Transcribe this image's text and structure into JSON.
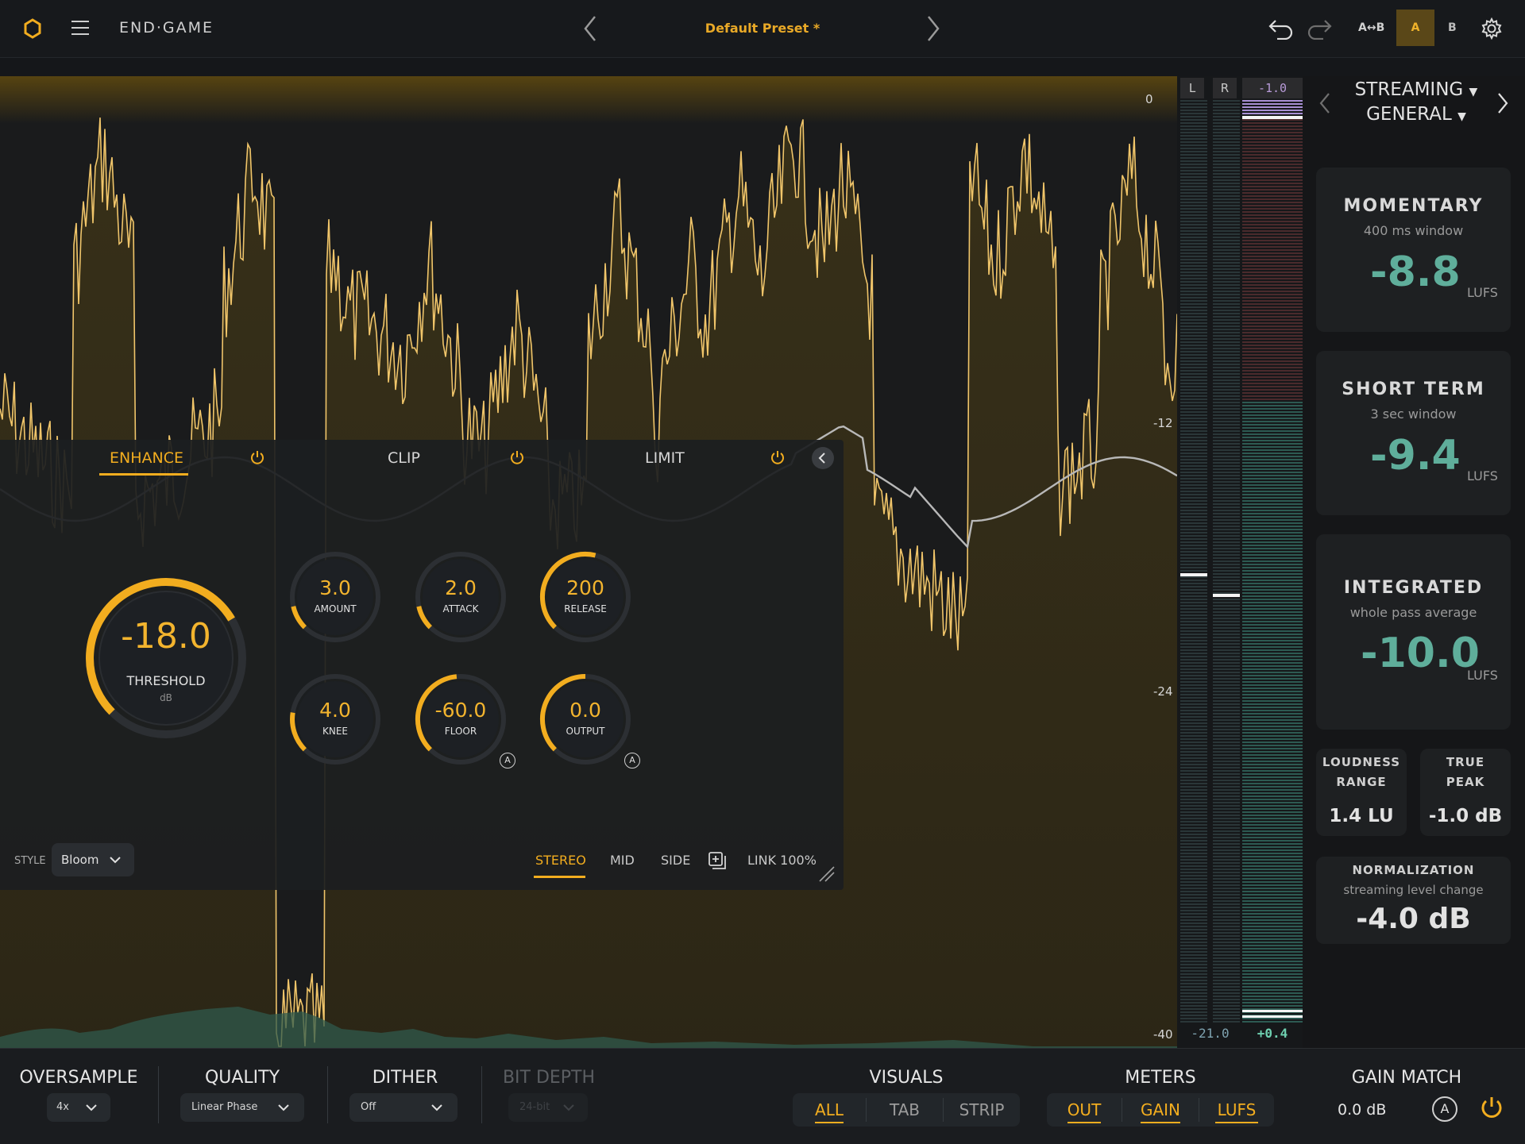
{
  "header": {
    "brand": "END·GAME",
    "preset": "Default Preset *",
    "ab_compare": "A↔B",
    "slot_a": "A",
    "slot_b": "B"
  },
  "spectrum": {
    "db_labels": [
      "0",
      "-12",
      "-24",
      "-40"
    ]
  },
  "meters": {
    "left_label": "L",
    "right_label": "R",
    "peak_top": "-1.0",
    "bottom_left": "-21.0",
    "bottom_right": "+0.4"
  },
  "panel": {
    "tabs": [
      "ENHANCE",
      "CLIP",
      "LIMIT"
    ],
    "active_tab": "ENHANCE",
    "threshold": {
      "value": "-18.0",
      "label": "THRESHOLD",
      "unit": "dB",
      "level": 0.72
    },
    "knobs": [
      {
        "value": "3.0",
        "label": "AMOUNT",
        "level": 0.12
      },
      {
        "value": "2.0",
        "label": "ATTACK",
        "level": 0.12
      },
      {
        "value": "200",
        "label": "RELEASE",
        "level": 0.55
      },
      {
        "value": "4.0",
        "label": "KNEE",
        "level": 0.2
      },
      {
        "value": "-60.0",
        "label": "FLOOR",
        "level": 0.48
      },
      {
        "value": "0.0",
        "label": "OUTPUT",
        "level": 0.5
      }
    ],
    "auto_badge": "A",
    "style_label": "STYLE",
    "style_value": "Bloom",
    "modes": [
      "STEREO",
      "MID",
      "SIDE"
    ],
    "active_mode": "STEREO",
    "link": "LINK 100%"
  },
  "loudness": {
    "standard": "STREAMING",
    "profile": "GENERAL",
    "momentary": {
      "title": "MOMENTARY",
      "sub": "400 ms window",
      "value": "-8.8",
      "unit": "LUFS"
    },
    "short_term": {
      "title": "SHORT TERM",
      "sub": "3 sec window",
      "value": "-9.4",
      "unit": "LUFS"
    },
    "integrated": {
      "title": "INTEGRATED",
      "sub": "whole pass average",
      "value": "-10.0",
      "unit": "LUFS"
    },
    "loudness_range": {
      "title_1": "LOUDNESS",
      "title_2": "RANGE",
      "value": "1.4 LU"
    },
    "true_peak": {
      "title_1": "TRUE",
      "title_2": "PEAK",
      "value": "-1.0 dB"
    },
    "normalization": {
      "title": "NORMALIZATION",
      "sub": "streaming level change",
      "value": "-4.0 dB"
    }
  },
  "footer": {
    "oversample": {
      "title": "OVERSAMPLE",
      "value": "4x"
    },
    "quality": {
      "title": "QUALITY",
      "value": "Linear Phase"
    },
    "dither": {
      "title": "DITHER",
      "value": "Off"
    },
    "bit_depth": {
      "title": "BIT DEPTH",
      "value": "24-bit"
    },
    "visuals": {
      "title": "VISUALS",
      "items": [
        "ALL",
        "TAB",
        "STRIP"
      ]
    },
    "meters": {
      "title": "METERS",
      "items": [
        "OUT",
        "GAIN",
        "LUFS"
      ]
    },
    "gain_match": {
      "title": "GAIN MATCH",
      "value": "0.0 dB",
      "auto": "A"
    }
  },
  "colors": {
    "accent": "#f2ad1f",
    "loudness_value": "#5fae9b",
    "waveform": "#f0c56a",
    "background": "#15171a"
  }
}
